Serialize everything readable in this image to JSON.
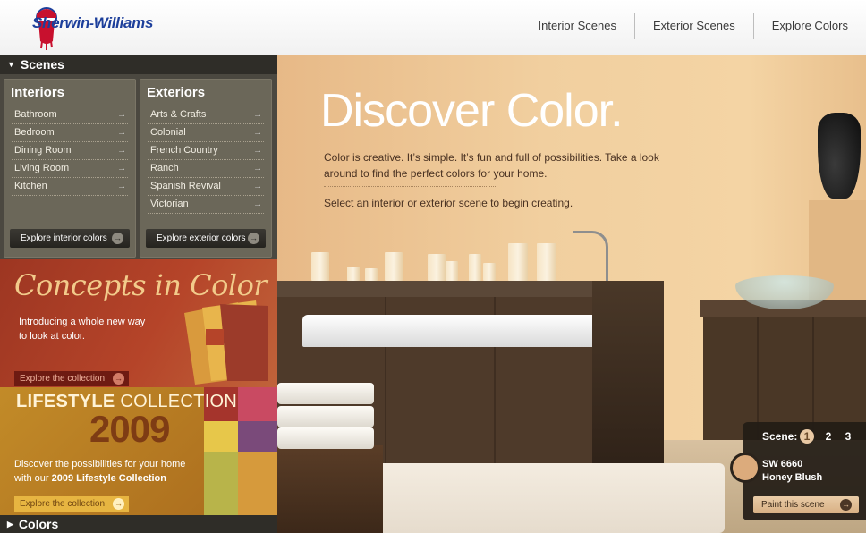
{
  "brand": {
    "name_small": "Sherwin",
    "name_big": "Williams"
  },
  "nav": {
    "items": [
      {
        "label": "Interior Scenes"
      },
      {
        "label": "Exterior Scenes"
      },
      {
        "label": "Explore Colors"
      }
    ]
  },
  "sidebar": {
    "scenes_label": "Scenes",
    "colors_label": "Colors",
    "interiors": {
      "title": "Interiors",
      "items": [
        {
          "label": "Bathroom"
        },
        {
          "label": "Bedroom"
        },
        {
          "label": "Dining Room"
        },
        {
          "label": "Living Room"
        },
        {
          "label": "Kitchen"
        }
      ],
      "button": "Explore interior colors"
    },
    "exteriors": {
      "title": "Exteriors",
      "items": [
        {
          "label": "Arts & Crafts"
        },
        {
          "label": "Colonial"
        },
        {
          "label": "French Country"
        },
        {
          "label": "Ranch"
        },
        {
          "label": "Spanish Revival"
        },
        {
          "label": "Victorian"
        }
      ],
      "button": "Explore exterior colors"
    }
  },
  "promos": {
    "concepts": {
      "title": "Concepts in Color",
      "desc_line1": "Introducing a whole new way",
      "desc_line2": "to look at color.",
      "button": "Explore the collection"
    },
    "lifestyle": {
      "title_bold": "LIFESTYLE",
      "title_rest": "COLLECTION",
      "year": "2009",
      "desc_line1": "Discover the possibilities for your home",
      "desc_line2_prefix": "with our",
      "desc_line2_bold": "2009 Lifestyle Collection",
      "button": "Explore the collection"
    }
  },
  "hero": {
    "title": "Discover Color.",
    "desc": "Color is creative. It’s simple. It’s fun and full of possibilities. Take a look around to find the perfect colors for your home.",
    "instruction": "Select an interior or exterior scene to begin creating."
  },
  "scene_panel": {
    "label": "Scene:",
    "numbers": [
      "1",
      "2",
      "3"
    ],
    "color_code": "SW 6660",
    "color_name": "Honey Blush",
    "button": "Paint this scene"
  },
  "colors": {
    "brand_blue": "#1d3f9b",
    "swatch": "#dcab7c",
    "concepts_bg": "#b54429",
    "lifestyle_bg": "#c28b28"
  }
}
